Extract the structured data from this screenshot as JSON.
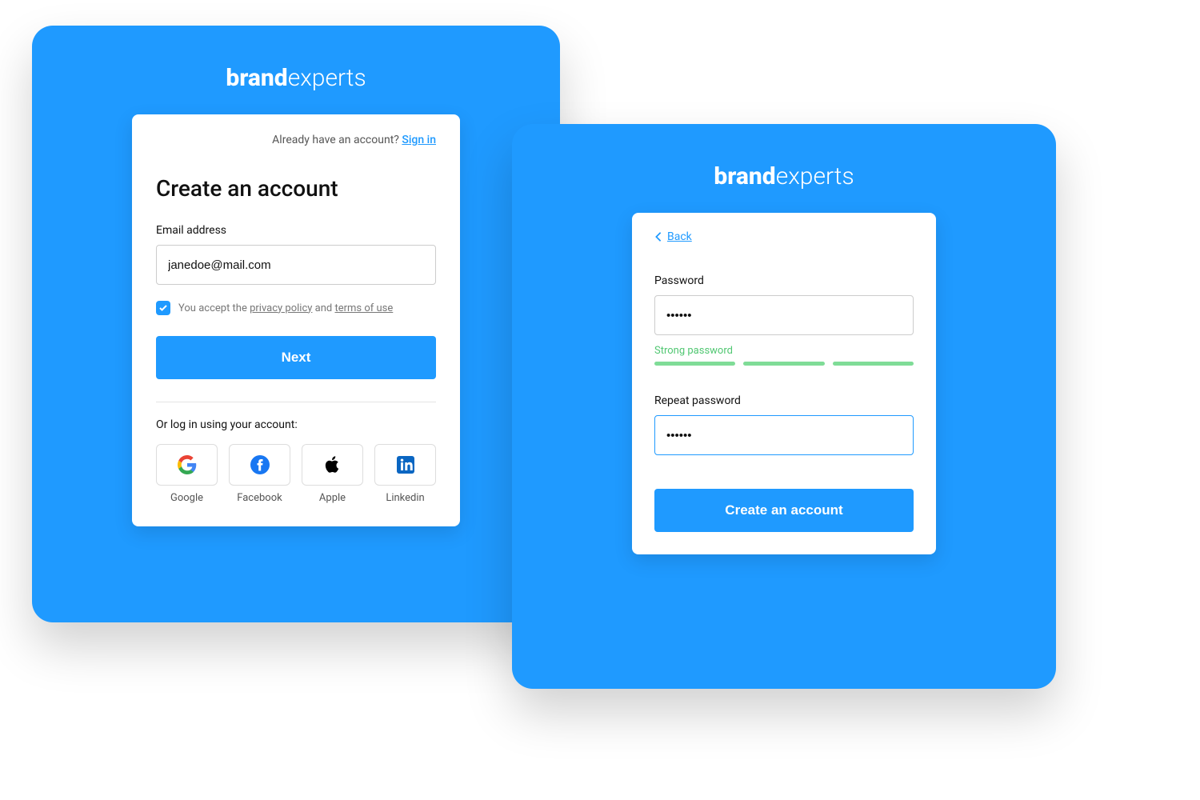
{
  "brand": {
    "bold": "brand",
    "light": "experts"
  },
  "left": {
    "topline": {
      "text": "Already have an account?",
      "link": "Sign in"
    },
    "title": "Create an account",
    "email": {
      "label": "Email address",
      "value": "janedoe@mail.com"
    },
    "terms": {
      "prefix": "You accept the",
      "link1": "privacy policy",
      "mid": "and",
      "link2": "terms of use",
      "checked": true
    },
    "next": "Next",
    "social_label": "Or log in using your account:",
    "social": [
      {
        "name": "Google"
      },
      {
        "name": "Facebook"
      },
      {
        "name": "Apple"
      },
      {
        "name": "Linkedin"
      }
    ]
  },
  "right": {
    "back": "Back",
    "password": {
      "label": "Password",
      "value": "••••••"
    },
    "strength": "Strong password",
    "repeat": {
      "label": "Repeat password",
      "value": "••••••"
    },
    "submit": "Create an account"
  }
}
